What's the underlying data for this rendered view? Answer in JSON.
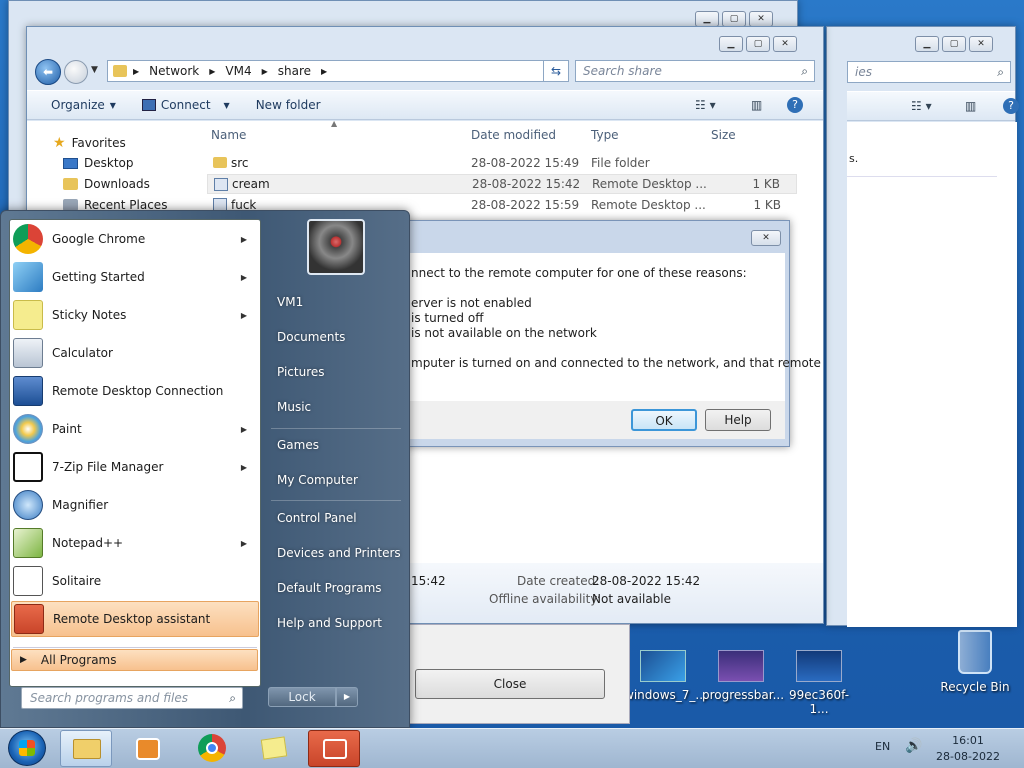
{
  "desktop": {
    "icons": [
      {
        "label": "windows_7_..."
      },
      {
        "label": "progressbar..."
      },
      {
        "label": "99ec360f-1..."
      },
      {
        "label": "Recycle Bin"
      }
    ]
  },
  "back_window": {
    "search_placeholder": "ies",
    "status_text": "s."
  },
  "explorer": {
    "breadcrumb": [
      "Network",
      "VM4",
      "share"
    ],
    "search_placeholder": "Search share",
    "toolbar": {
      "organize": "Organize",
      "connect": "Connect",
      "new_folder": "New folder"
    },
    "nav": {
      "favorites": "Favorites",
      "desktop": "Desktop",
      "downloads": "Downloads",
      "recent": "Recent Places"
    },
    "columns": {
      "name": "Name",
      "date": "Date modified",
      "type": "Type",
      "size": "Size"
    },
    "files": [
      {
        "name": "src",
        "date": "28-08-2022 15:49",
        "type": "File folder",
        "size": ""
      },
      {
        "name": "cream",
        "date": "28-08-2022 15:42",
        "type": "Remote Desktop ...",
        "size": "1 KB"
      },
      {
        "name": "fuck",
        "date": "28-08-2022 15:59",
        "type": "Remote Desktop ...",
        "size": "1 KB"
      }
    ],
    "details": {
      "modified_partial": "15:42",
      "created_label": "Date created:",
      "created_value": "28-08-2022 15:42",
      "offline_label": "Offline availability:",
      "offline_value": "Not available"
    }
  },
  "error_dialog": {
    "line1": "nnect to the remote computer for one of these reasons:",
    "line2": "erver is not enabled",
    "line3": "is turned off",
    "line4": "is not available on the network",
    "line5": "mputer is turned on and connected to the network, and that remote",
    "ok": "OK",
    "help": "Help"
  },
  "close_dialog": {
    "close": "Close"
  },
  "start_menu": {
    "left_items": [
      {
        "label": "Google Chrome",
        "arrow": "▶"
      },
      {
        "label": "Getting Started",
        "arrow": "▶"
      },
      {
        "label": "Sticky Notes",
        "arrow": "▶"
      },
      {
        "label": "Calculator",
        "arrow": ""
      },
      {
        "label": "Remote Desktop Connection",
        "arrow": ""
      },
      {
        "label": "Paint",
        "arrow": "▶"
      },
      {
        "label": "7-Zip File Manager",
        "arrow": "▶"
      },
      {
        "label": "Magnifier",
        "arrow": ""
      },
      {
        "label": "Notepad++",
        "arrow": "▶"
      },
      {
        "label": "Solitaire",
        "arrow": ""
      },
      {
        "label": "Remote Desktop assistant",
        "arrow": ""
      }
    ],
    "all_programs": "All Programs",
    "search_placeholder": "Search programs and files",
    "right_items": [
      "VM1",
      "Documents",
      "Pictures",
      "Music",
      "Games",
      "My Computer",
      "Control Panel",
      "Devices and Printers",
      "Default Programs",
      "Help and Support"
    ],
    "lock": "Lock"
  },
  "taskbar": {
    "lang": "EN",
    "time": "16:01",
    "date": "28-08-2022"
  },
  "colors": {
    "accent": "#3c7fb1",
    "highlight": "#fbd3a8"
  }
}
